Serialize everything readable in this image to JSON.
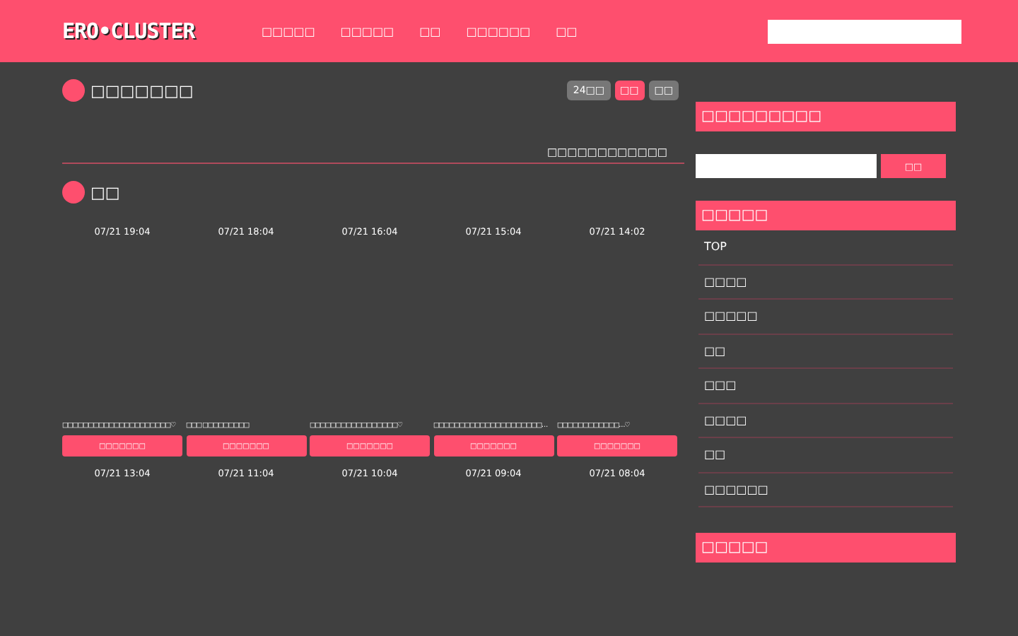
{
  "header": {
    "logo": "ERO•CLUSTER",
    "nav": [
      "□□□□□",
      "□□□□□",
      "□□",
      "□□□□□□",
      "□□"
    ]
  },
  "ranking": {
    "title": "□□□□□□□",
    "periods": [
      {
        "label": "24□□",
        "selected": false
      },
      {
        "label": "□□",
        "selected": true
      },
      {
        "label": "□□",
        "selected": false
      }
    ],
    "more_link": "□□□□□□□□□□□□"
  },
  "latest": {
    "title": "□□",
    "posts": [
      {
        "time": "07/21 19:04",
        "title": "□□□□□□□□□□□□□□□□□□□□□♡",
        "button": "□□□□□□□"
      },
      {
        "time": "07/21 18:04",
        "title": "□□□ □□□□□□□□□",
        "button": "□□□□□□□"
      },
      {
        "time": "07/21 16:04",
        "title": "□□□□□□□□□□□□□□□□□♡",
        "button": "□□□□□□□"
      },
      {
        "time": "07/21 15:04",
        "title": "□□□□□□□□□□□□□□□□□□□□□…",
        "button": "□□□□□□□"
      },
      {
        "time": "07/21 14:02",
        "title": "□□□□□□□□□□□□…♡",
        "button": "□□□□□□□"
      },
      {
        "time": "07/21 13:04"
      },
      {
        "time": "07/21 11:04"
      },
      {
        "time": "07/21 10:04"
      },
      {
        "time": "07/21 09:04"
      },
      {
        "time": "07/21 08:04"
      }
    ]
  },
  "sidebar": {
    "search_title": "□□□□□□□□□",
    "search_button": "□□",
    "menu_title": "□□□□□",
    "menu": [
      "TOP",
      "□□□□",
      "□□□□□",
      "□□",
      "□□□",
      "□□□□",
      "□□",
      "□□□□□□"
    ],
    "bottom_title": "□□□□□"
  }
}
